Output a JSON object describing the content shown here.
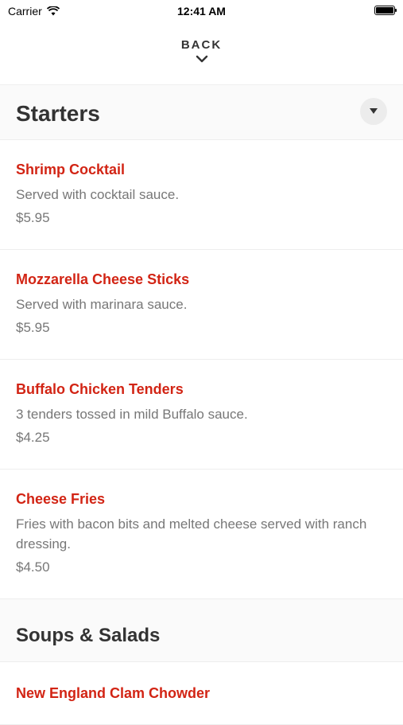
{
  "status_bar": {
    "carrier": "Carrier",
    "time": "12:41 AM"
  },
  "back": {
    "label": "BACK"
  },
  "sections": [
    {
      "title": "Starters",
      "items": [
        {
          "name": "Shrimp Cocktail",
          "description": "Served with cocktail sauce.",
          "price": "$5.95"
        },
        {
          "name": "Mozzarella Cheese Sticks",
          "description": "Served with marinara sauce.",
          "price": "$5.95"
        },
        {
          "name": "Buffalo Chicken Tenders",
          "description": "3 tenders tossed in mild Buffalo sauce.",
          "price": "$4.25"
        },
        {
          "name": "Cheese Fries",
          "description": "Fries with bacon bits and melted cheese served with ranch dressing.",
          "price": "$4.50"
        }
      ]
    },
    {
      "title": "Soups & Salads",
      "items": [
        {
          "name": "New England Clam Chowder"
        }
      ]
    }
  ],
  "icons": {
    "wifi": "wifi-icon",
    "battery": "battery-icon",
    "back": "chevron-down-icon",
    "toggle": "caret-down-icon"
  },
  "colors": {
    "item_name": "#d22414",
    "text": "#333333",
    "muted": "#777777"
  }
}
